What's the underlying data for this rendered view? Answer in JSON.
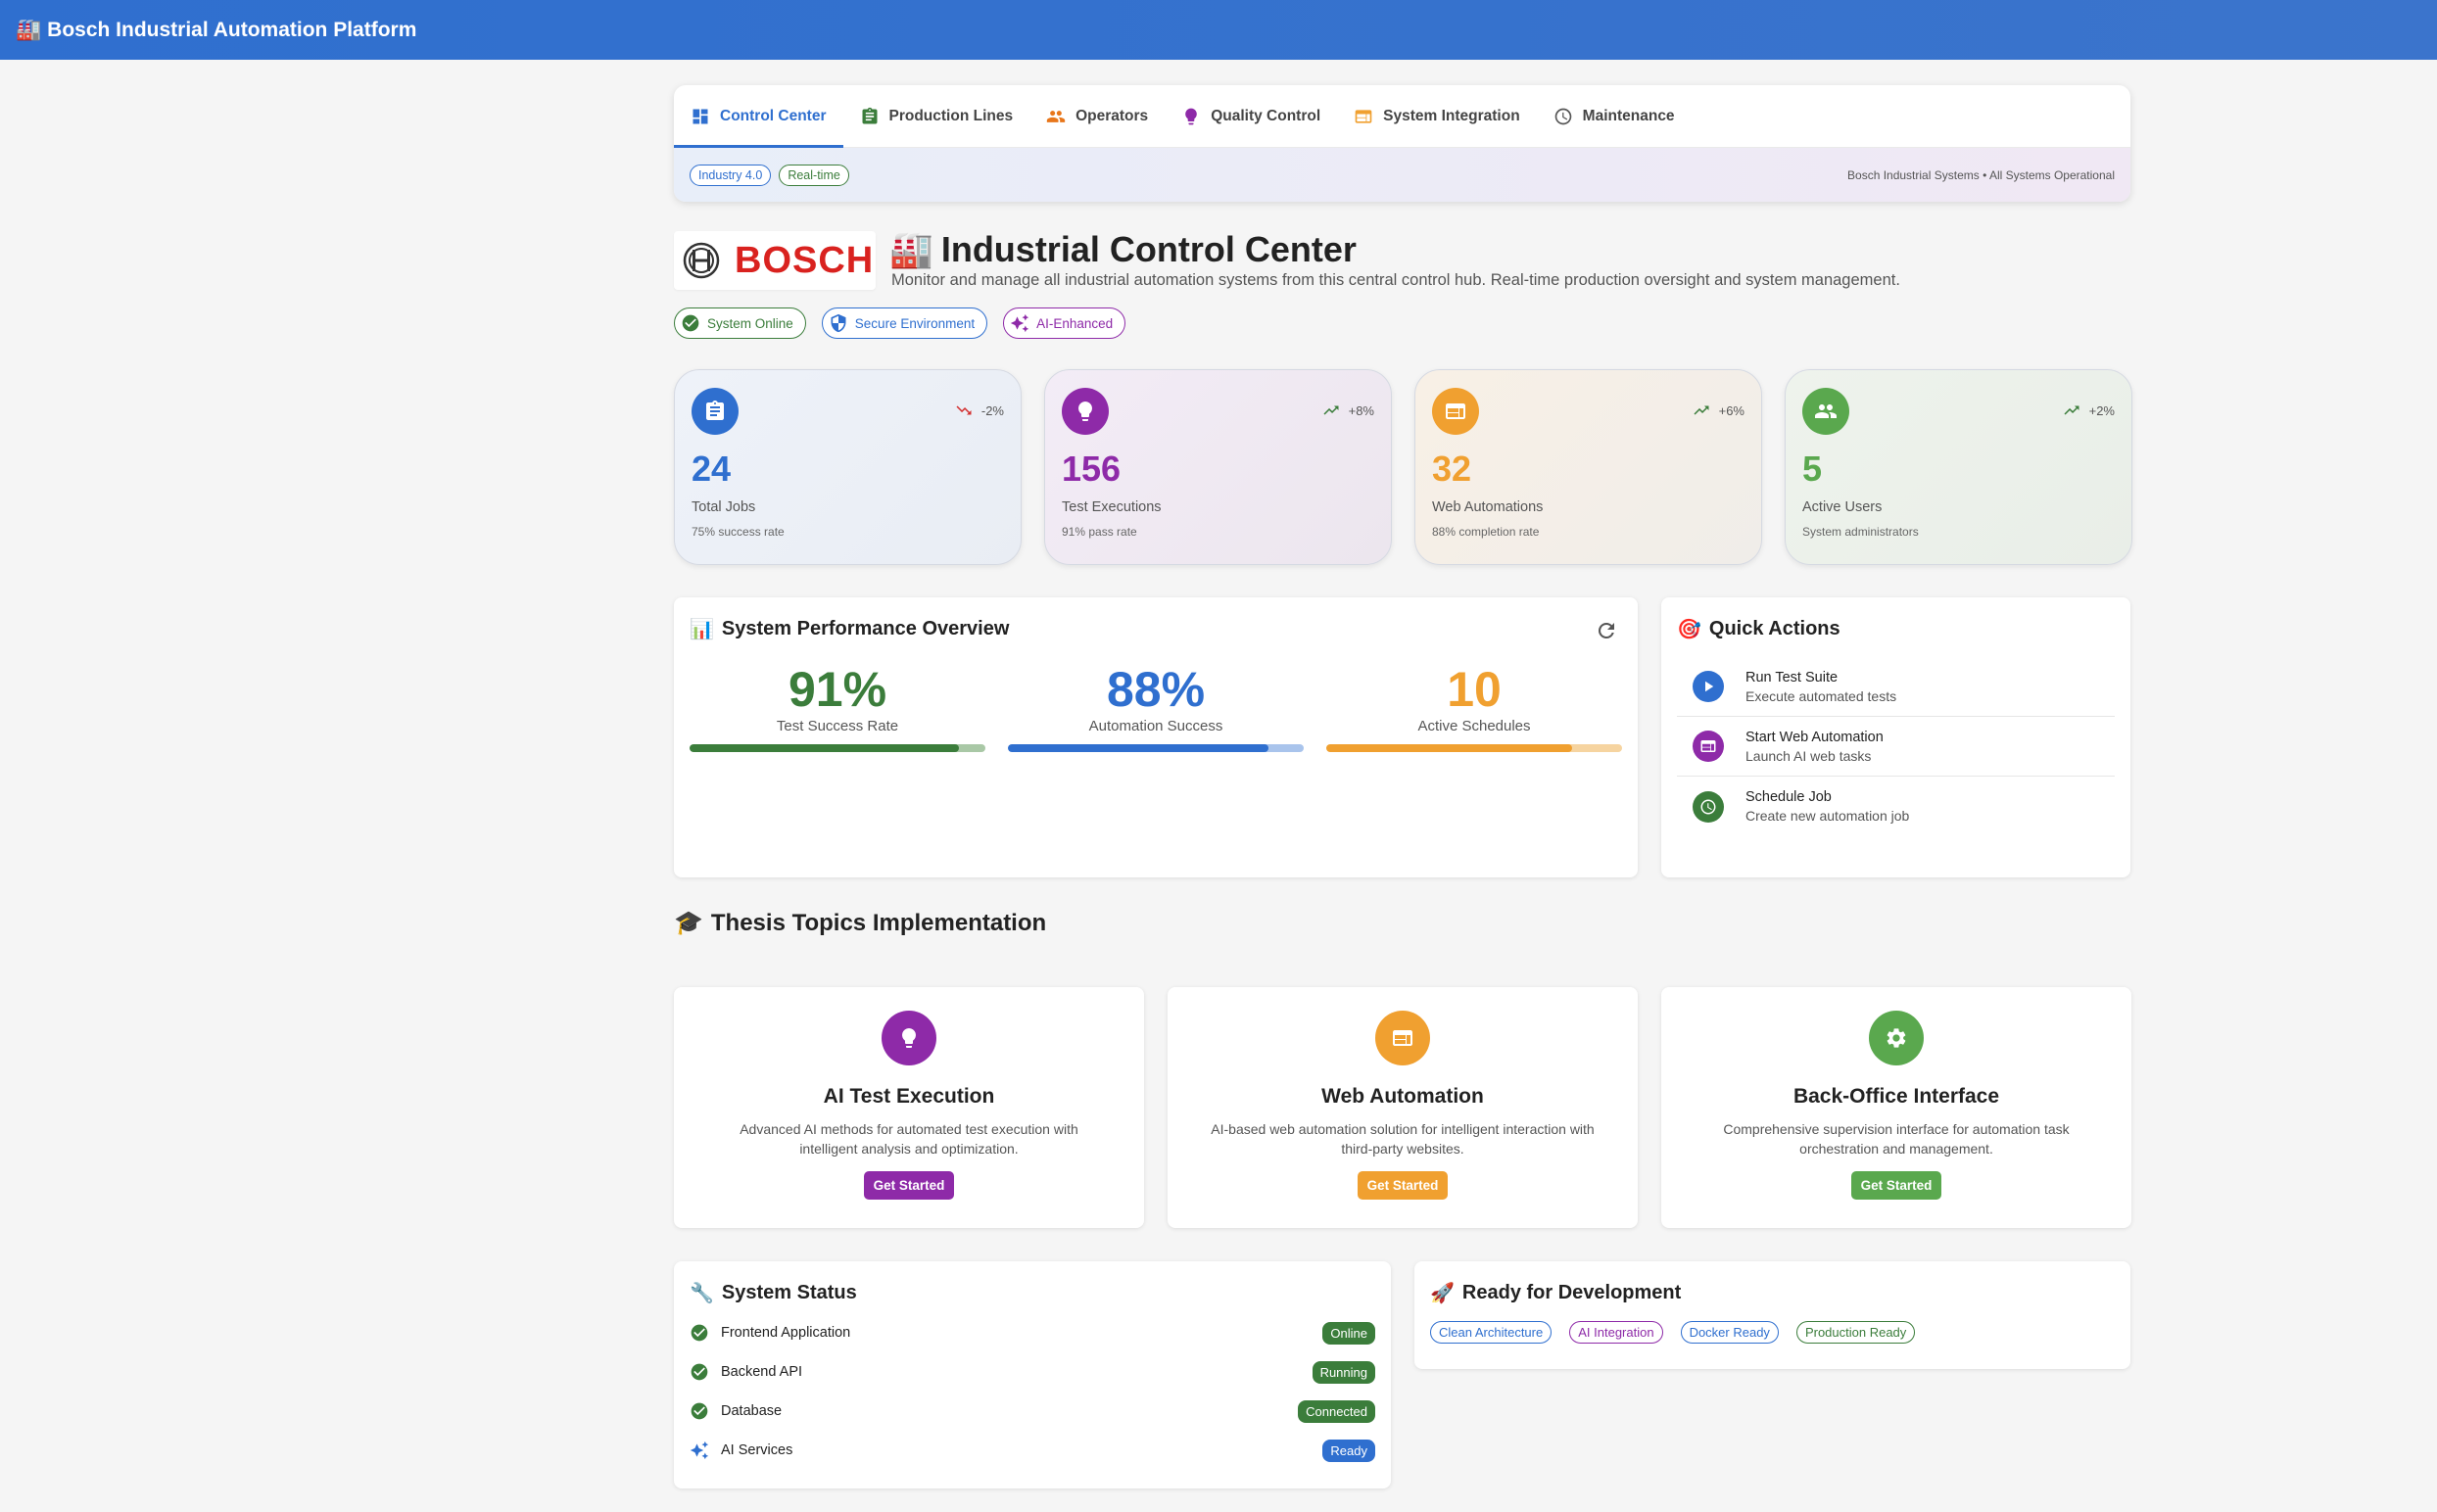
{
  "app": {
    "icon": "🏭",
    "title": "Bosch Industrial Automation Platform"
  },
  "tabs": [
    {
      "label": "Control Center",
      "icon": "dashboard-icon",
      "color": "#2f6fcf",
      "active": true
    },
    {
      "label": "Production Lines",
      "icon": "clipboard-icon",
      "color": "#3b7d3b"
    },
    {
      "label": "Operators",
      "icon": "people-icon",
      "color": "#e8761a"
    },
    {
      "label": "Quality Control",
      "icon": "bulb-icon",
      "color": "#8e2aa8"
    },
    {
      "label": "System Integration",
      "icon": "web-icon",
      "color": "#f0a030"
    },
    {
      "label": "Maintenance",
      "icon": "clock-icon",
      "color": "#555555"
    }
  ],
  "subbar": {
    "chips": [
      {
        "label": "Industry 4.0",
        "color": "#2f6fcf"
      },
      {
        "label": "Real-time",
        "color": "#3b7d3b"
      }
    ],
    "status": "Bosch Industrial Systems • All Systems Operational"
  },
  "header": {
    "logo_text": "BOSCH",
    "title_icon": "🏭",
    "title": "Industrial Control Center",
    "subtitle": "Monitor and manage all industrial automation systems from this central control hub. Real-time production oversight and system management.",
    "badges": [
      {
        "label": "System Online",
        "color": "#3b7d3b",
        "icon": "check-circle-icon"
      },
      {
        "label": "Secure Environment",
        "color": "#2f6fcf",
        "icon": "shield-icon"
      },
      {
        "label": "AI-Enhanced",
        "color": "#8e2aa8",
        "icon": "sparkle-icon"
      }
    ]
  },
  "stats": [
    {
      "value": "24",
      "label": "Total Jobs",
      "note": "75% success rate",
      "trend": "-2%",
      "trend_dir": "down",
      "color": "#2f6fcf",
      "icon": "clipboard-icon",
      "bg": "linear-gradient(135deg,#eef2f9,#e9edf4)"
    },
    {
      "value": "156",
      "label": "Test Executions",
      "note": "91% pass rate",
      "trend": "+8%",
      "trend_dir": "up",
      "color": "#8e2aa8",
      "icon": "bulb-icon",
      "bg": "linear-gradient(135deg,#f3ecf6,#ece6ee)"
    },
    {
      "value": "32",
      "label": "Web Automations",
      "note": "88% completion rate",
      "trend": "+6%",
      "trend_dir": "up",
      "color": "#f0a030",
      "icon": "web-icon",
      "bg": "linear-gradient(135deg,#f8f0e6,#f0ede9)"
    },
    {
      "value": "5",
      "label": "Active Users",
      "note": "System administrators",
      "trend": "+2%",
      "trend_dir": "up",
      "color": "#5aa84e",
      "icon": "people-icon",
      "bg": "linear-gradient(135deg,#eef3ec,#e9eee8)"
    }
  ],
  "performance": {
    "icon": "📊",
    "title": "System Performance Overview",
    "metrics": [
      {
        "value": "91%",
        "label": "Test Success Rate",
        "color": "#3b7d3b",
        "track": "#a9c8a6",
        "fill_fraction": 0.91
      },
      {
        "value": "88%",
        "label": "Automation Success",
        "color": "#2f6fcf",
        "track": "#a9c4ec",
        "fill_fraction": 0.88
      },
      {
        "value": "10",
        "label": "Active Schedules",
        "color": "#f0a030",
        "track": "#f6d4a0",
        "fill_fraction": 0.83
      }
    ]
  },
  "quick_actions": {
    "icon": "🎯",
    "title": "Quick Actions",
    "items": [
      {
        "title": "Run Test Suite",
        "sub": "Execute automated tests",
        "color": "#2f6fcf",
        "icon": "play-icon"
      },
      {
        "title": "Start Web Automation",
        "sub": "Launch AI web tasks",
        "color": "#8e2aa8",
        "icon": "web-icon"
      },
      {
        "title": "Schedule Job",
        "sub": "Create new automation job",
        "color": "#3b7d3b",
        "icon": "clock-icon"
      }
    ]
  },
  "thesis": {
    "icon": "🎓",
    "title": "Thesis Topics Implementation",
    "topics": [
      {
        "title": "AI Test Execution",
        "desc": "Advanced AI methods for automated test execution with intelligent analysis and optimization.",
        "button": "Get Started",
        "color": "#8e2aa8",
        "icon": "bulb-icon"
      },
      {
        "title": "Web Automation",
        "desc": "AI-based web automation solution for intelligent interaction with third-party websites.",
        "button": "Get Started",
        "color": "#f0a030",
        "icon": "web-icon"
      },
      {
        "title": "Back-Office Interface",
        "desc": "Comprehensive supervision interface for automation task orchestration and management.",
        "button": "Get Started",
        "color": "#5aa84e",
        "icon": "gear-icon"
      }
    ]
  },
  "system_status": {
    "icon": "🔧",
    "title": "System Status",
    "rows": [
      {
        "name": "Frontend Application",
        "status": "Online",
        "color": "#3b7d3b",
        "icon": "check-circle-icon"
      },
      {
        "name": "Backend API",
        "status": "Running",
        "color": "#3b7d3b",
        "icon": "check-circle-icon"
      },
      {
        "name": "Database",
        "status": "Connected",
        "color": "#3b7d3b",
        "icon": "check-circle-icon"
      },
      {
        "name": "AI Services",
        "status": "Ready",
        "color": "#2f6fcf",
        "icon": "sparkle-icon"
      }
    ]
  },
  "dev": {
    "icon": "🚀",
    "title": "Ready for Development",
    "tags": [
      {
        "label": "Clean Architecture",
        "color": "#2f6fcf"
      },
      {
        "label": "AI Integration",
        "color": "#8e2aa8"
      },
      {
        "label": "Docker Ready",
        "color": "#2f6fcf"
      },
      {
        "label": "Production Ready",
        "color": "#3b7d3b"
      }
    ]
  }
}
